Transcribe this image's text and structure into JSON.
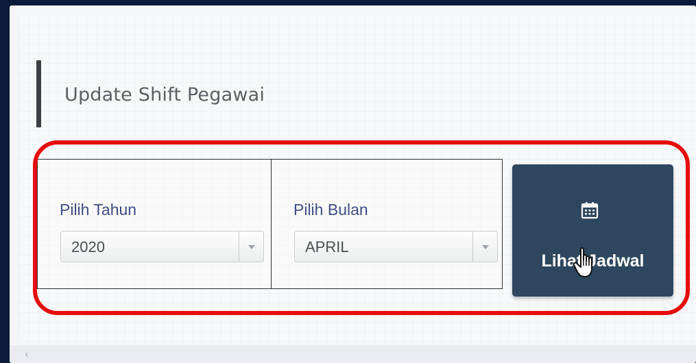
{
  "page": {
    "title": "Update Shift Pegawai"
  },
  "form": {
    "year": {
      "label": "Pilih Tahun",
      "selected": "2020"
    },
    "month": {
      "label": "Pilih Bulan",
      "selected": "APRIL"
    },
    "submit": {
      "label": "Lihat Jadwal",
      "icon": "calendar-icon"
    }
  },
  "colors": {
    "button_bg": "#2e475f",
    "highlight": "#e60d0d",
    "label": "#3f4d83",
    "frame_bg": "#0b1a38"
  }
}
